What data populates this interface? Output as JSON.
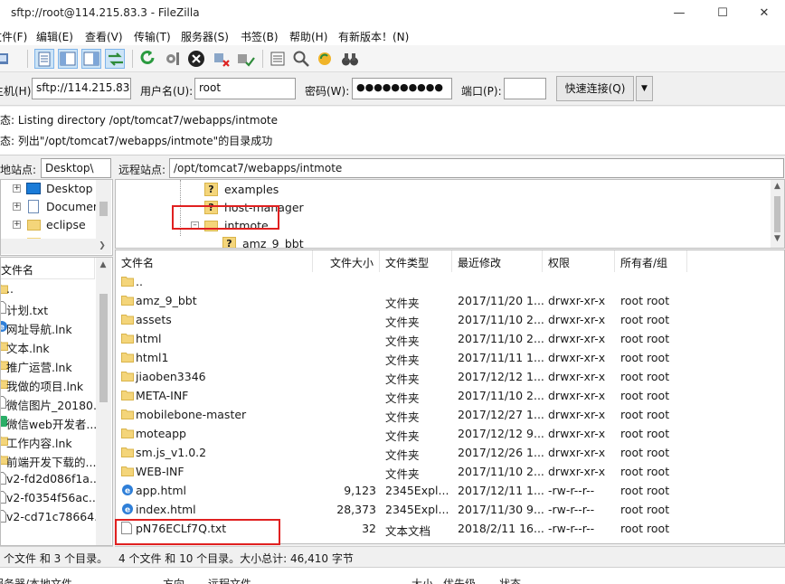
{
  "window": {
    "title": "sftp://root@114.215.83.3 - FileZilla"
  },
  "menu": [
    "文件(F)",
    "编辑(E)",
    "查看(V)",
    "传输(T)",
    "服务器(S)",
    "书签(B)",
    "帮助(H)",
    "有新版本！(N)"
  ],
  "quickconnect": {
    "host_label": "主机(H):",
    "host_value": "sftp://114.215.83.3",
    "user_label": "用户名(U):",
    "user_value": "root",
    "pass_label": "密码(W):",
    "pass_value": "●●●●●●●●●●",
    "port_label": "端口(P):",
    "port_value": "",
    "button": "快速连接(Q)",
    "dropdown_icon": "▼"
  },
  "log": [
    {
      "prefix": "状态:",
      "text": "Listing directory /opt/tomcat7/webapps/intmote"
    },
    {
      "prefix": "状态:",
      "text": "列出\"/opt/tomcat7/webapps/intmote\"的目录成功"
    }
  ],
  "local": {
    "site_label": "本地站点:",
    "site_path": "Desktop\\",
    "tree": [
      {
        "name": "Desktop",
        "icon": "desktop-icon"
      },
      {
        "name": "Documents",
        "icon": "documents-icon"
      },
      {
        "name": "eclipse",
        "icon": "folder-icon"
      }
    ],
    "list_header": "文件名",
    "files": [
      {
        "name": "..",
        "icon": "folder-icon"
      },
      {
        "name": "计划.txt",
        "icon": "file-icon"
      },
      {
        "name": "网址导航.lnk",
        "icon": "ie-icon"
      },
      {
        "name": "文本.lnk",
        "icon": "folder-icon"
      },
      {
        "name": "推广运营.lnk",
        "icon": "folder-icon"
      },
      {
        "name": "我做的项目.lnk",
        "icon": "folder-icon"
      },
      {
        "name": "微信图片_20180...",
        "icon": "file-icon"
      },
      {
        "name": "微信web开发者...",
        "icon": "wechat-icon"
      },
      {
        "name": "工作内容.lnk",
        "icon": "folder-icon"
      },
      {
        "name": "前端开发下载的...",
        "icon": "folder-icon"
      },
      {
        "name": "v2-fd2d086f1a...",
        "icon": "file-icon"
      },
      {
        "name": "v2-f0354f56ac...",
        "icon": "file-icon"
      },
      {
        "name": "v2-cd71c78664...",
        "icon": "file-icon"
      }
    ],
    "status": "个文件 和 3 个目录。"
  },
  "remote": {
    "site_label": "远程站点:",
    "site_path": "/opt/tomcat7/webapps/intmote",
    "tree": [
      {
        "name": "examples",
        "icon": "unknown-folder-icon"
      },
      {
        "name": "host-manager",
        "icon": "unknown-folder-icon"
      },
      {
        "name": "intmote",
        "icon": "folder-icon"
      },
      {
        "name": "amz_9_bbt",
        "icon": "unknown-folder-icon"
      }
    ],
    "columns": [
      "文件名",
      "文件大小",
      "文件类型",
      "最近修改",
      "权限",
      "所有者/组"
    ],
    "files": [
      {
        "name": "..",
        "size": "",
        "type": "",
        "modified": "",
        "perm": "",
        "owner": "",
        "icon": "folder-icon"
      },
      {
        "name": "amz_9_bbt",
        "size": "",
        "type": "文件夹",
        "modified": "2017/11/20 1...",
        "perm": "drwxr-xr-x",
        "owner": "root root",
        "icon": "folder-icon"
      },
      {
        "name": "assets",
        "size": "",
        "type": "文件夹",
        "modified": "2017/11/10 2...",
        "perm": "drwxr-xr-x",
        "owner": "root root",
        "icon": "folder-icon"
      },
      {
        "name": "html",
        "size": "",
        "type": "文件夹",
        "modified": "2017/11/10 2...",
        "perm": "drwxr-xr-x",
        "owner": "root root",
        "icon": "folder-icon"
      },
      {
        "name": "html1",
        "size": "",
        "type": "文件夹",
        "modified": "2017/11/11 1...",
        "perm": "drwxr-xr-x",
        "owner": "root root",
        "icon": "folder-icon"
      },
      {
        "name": "jiaoben3346",
        "size": "",
        "type": "文件夹",
        "modified": "2017/12/12 1...",
        "perm": "drwxr-xr-x",
        "owner": "root root",
        "icon": "folder-icon"
      },
      {
        "name": "META-INF",
        "size": "",
        "type": "文件夹",
        "modified": "2017/11/10 2...",
        "perm": "drwxr-xr-x",
        "owner": "root root",
        "icon": "folder-icon"
      },
      {
        "name": "mobilebone-master",
        "size": "",
        "type": "文件夹",
        "modified": "2017/12/27 1...",
        "perm": "drwxr-xr-x",
        "owner": "root root",
        "icon": "folder-icon"
      },
      {
        "name": "moteapp",
        "size": "",
        "type": "文件夹",
        "modified": "2017/12/12 9...",
        "perm": "drwxr-xr-x",
        "owner": "root root",
        "icon": "folder-icon"
      },
      {
        "name": "sm.js_v1.0.2",
        "size": "",
        "type": "文件夹",
        "modified": "2017/12/26 1...",
        "perm": "drwxr-xr-x",
        "owner": "root root",
        "icon": "folder-icon"
      },
      {
        "name": "WEB-INF",
        "size": "",
        "type": "文件夹",
        "modified": "2017/11/10 2...",
        "perm": "drwxr-xr-x",
        "owner": "root root",
        "icon": "folder-icon"
      },
      {
        "name": "app.html",
        "size": "9,123",
        "type": "2345Expl...",
        "modified": "2017/12/11 1...",
        "perm": "-rw-r--r--",
        "owner": "root root",
        "icon": "ie-icon"
      },
      {
        "name": "index.html",
        "size": "28,373",
        "type": "2345Expl...",
        "modified": "2017/11/30 9...",
        "perm": "-rw-r--r--",
        "owner": "root root",
        "icon": "ie-icon"
      },
      {
        "name": "pN76ECLf7Q.txt",
        "size": "32",
        "type": "文本文档",
        "modified": "2018/2/11 16...",
        "perm": "-rw-r--r--",
        "owner": "root root",
        "icon": "file-icon"
      }
    ],
    "status": "4 个文件 和 10 个目录。大小总计: 46,410 字节"
  },
  "queue": {
    "columns": [
      "服务器/本地文件",
      "方向",
      "远程文件",
      "大小",
      "优先级",
      "状态"
    ]
  },
  "colors": {
    "folder": "#f4d57a",
    "folder_edge": "#d9b44a",
    "highlight": "#e02020",
    "toolbar_selected": "#cce4f7"
  }
}
